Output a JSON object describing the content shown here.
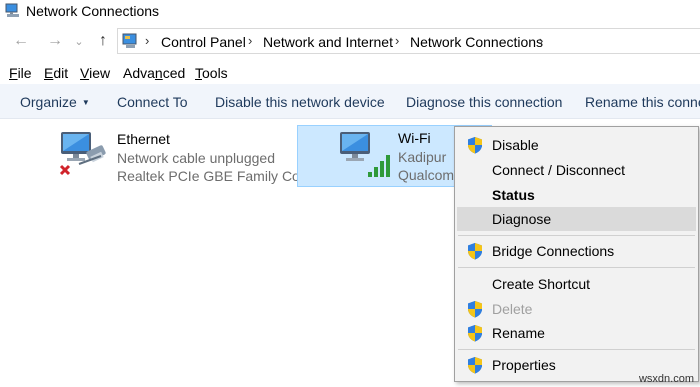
{
  "window": {
    "title": "Network Connections"
  },
  "nav": {
    "breadcrumb": [
      "Control Panel",
      "Network and Internet",
      "Network Connections"
    ]
  },
  "menubar": {
    "items": [
      {
        "pre": "",
        "key": "F",
        "post": "ile"
      },
      {
        "pre": "",
        "key": "E",
        "post": "dit"
      },
      {
        "pre": "",
        "key": "V",
        "post": "iew"
      },
      {
        "pre": "Adva",
        "key": "n",
        "post": "ced"
      },
      {
        "pre": "",
        "key": "T",
        "post": "ools"
      }
    ]
  },
  "commands": {
    "organize": "Organize",
    "connect_to": "Connect To",
    "disable_device": "Disable this network device",
    "diagnose": "Diagnose this connection",
    "rename": "Rename this connection"
  },
  "connections": [
    {
      "name": "Ethernet",
      "status": "Network cable unplugged",
      "device": "Realtek PCIe GBE Family Co...",
      "icon": "ethernet-disconnected-icon"
    },
    {
      "name": "Wi-Fi",
      "status": "Kadipur",
      "device": "Qualcomm",
      "icon": "wifi-adapter-icon",
      "selected": true
    }
  ],
  "context_menu": {
    "items": [
      {
        "label": "Disable",
        "shield": true
      },
      {
        "label": "Connect / Disconnect",
        "shield": false
      },
      {
        "label": "Status",
        "bold": true
      },
      {
        "label": "Diagnose",
        "highlighted": true
      },
      {
        "label": "Bridge Connections",
        "shield": true
      },
      {
        "label": "Create Shortcut",
        "shield": false
      },
      {
        "label": "Delete",
        "shield": true,
        "disabled": true
      },
      {
        "label": "Rename",
        "shield": true
      },
      {
        "label": "Properties",
        "shield": true
      }
    ]
  },
  "watermark": "wsxdn.com",
  "colors": {
    "command_bar_bg": "#f1f5fb",
    "command_text": "#1e395b",
    "selection_bg": "#cce8ff",
    "selection_border": "#99d1ff",
    "menu_bg": "#f2f2f2",
    "menu_highlight": "#dadada"
  }
}
